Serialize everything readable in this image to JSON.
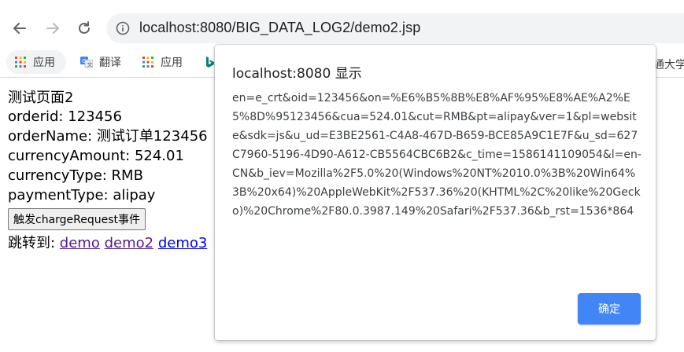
{
  "browser": {
    "url": "localhost:8080/BIG_DATA_LOG2/demo2.jsp",
    "icons": {
      "back": "arrow-left-icon",
      "forward": "arrow-right-icon",
      "reload": "reload-icon",
      "info": "info-icon"
    }
  },
  "bookmarks": {
    "items": [
      {
        "label": "应用",
        "icon": "apps-grid-icon"
      },
      {
        "label": "翻译",
        "icon": "translate-icon"
      },
      {
        "label": "应用",
        "icon": "apps-grid-icon"
      },
      {
        "label": "",
        "icon": "bing-icon"
      }
    ],
    "right_label": "通大学"
  },
  "page": {
    "heading": "测试页面2",
    "orderid": "orderid: 123456",
    "orderName": "orderName: 测试订单123456",
    "currencyAmount": "currencyAmount: 524.01",
    "currencyType": "currencyType: RMB",
    "paymentType": "paymentType: alipay",
    "button_label": "触发chargeRequest事件",
    "jump_label": "跳转到: ",
    "links": [
      "demo",
      "demo2",
      "demo3"
    ]
  },
  "dialog": {
    "title": "localhost:8080 显示",
    "message": "en=e_crt&oid=123456&on=%E6%B5%8B%E8%AF%95%E8%AE%A2%E5%8D%95123456&cua=524.01&cut=RMB&pt=alipay&ver=1&pl=website&sdk=js&u_ud=E3BE2561-C4A8-467D-B659-BCE85A9C1E7F&u_sd=627C7960-5196-4D90-A612-CB5564CBC6B2&c_time=1586141109054&l=en-CN&b_iev=Mozilla%2F5.0%20(Windows%20NT%2010.0%3B%20Win64%3B%20x64)%20AppleWebKit%2F537.36%20(KHTML%2C%20like%20Gecko)%20Chrome%2F80.0.3987.149%20Safari%2F537.36&b_rst=1536*864",
    "ok_label": "确定",
    "colors": {
      "ok_button": "#4285f4"
    }
  }
}
